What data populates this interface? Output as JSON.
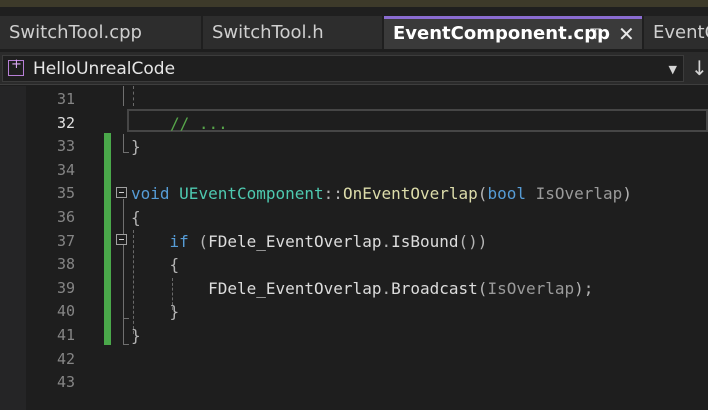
{
  "tabs": [
    {
      "label": "SwitchTool.cpp",
      "active": false
    },
    {
      "label": "SwitchTool.h",
      "active": false
    },
    {
      "label": "EventComponent.cpp",
      "active": true
    },
    {
      "label": "EventC",
      "active": false
    }
  ],
  "navbar": {
    "label": "HelloUnrealCode"
  },
  "current_line": 32,
  "lines": [
    {
      "num": "31",
      "segments": []
    },
    {
      "num": "32",
      "segments": [
        {
          "text": "// ...",
          "cls": "comment"
        }
      ]
    },
    {
      "num": "33",
      "segments": [
        {
          "text": "}",
          "cls": "punct"
        }
      ]
    },
    {
      "num": "34",
      "segments": []
    },
    {
      "num": "35",
      "segments": [
        {
          "text": "void",
          "cls": "kw"
        },
        {
          "text": " ",
          "cls": ""
        },
        {
          "text": "UEventComponent",
          "cls": "type"
        },
        {
          "text": "::",
          "cls": "punct"
        },
        {
          "text": "OnEventOverlap",
          "cls": "func"
        },
        {
          "text": "(",
          "cls": "punct"
        },
        {
          "text": "bool",
          "cls": "kw"
        },
        {
          "text": " ",
          "cls": ""
        },
        {
          "text": "IsOverlap",
          "cls": "param"
        },
        {
          "text": ")",
          "cls": "punct"
        }
      ]
    },
    {
      "num": "36",
      "segments": [
        {
          "text": "{",
          "cls": "punct"
        }
      ]
    },
    {
      "num": "37",
      "segments": [
        {
          "text": "    ",
          "cls": ""
        },
        {
          "text": "if",
          "cls": "kw"
        },
        {
          "text": " (",
          "cls": "punct"
        },
        {
          "text": "FDele_EventOverlap",
          "cls": ""
        },
        {
          "text": ".",
          "cls": "punct"
        },
        {
          "text": "IsBound",
          "cls": ""
        },
        {
          "text": "())",
          "cls": "punct"
        }
      ]
    },
    {
      "num": "38",
      "segments": [
        {
          "text": "    {",
          "cls": "punct"
        }
      ]
    },
    {
      "num": "39",
      "segments": [
        {
          "text": "        ",
          "cls": ""
        },
        {
          "text": "FDele_EventOverlap",
          "cls": ""
        },
        {
          "text": ".",
          "cls": "punct"
        },
        {
          "text": "Broadcast",
          "cls": ""
        },
        {
          "text": "(",
          "cls": "punct"
        },
        {
          "text": "IsOverlap",
          "cls": "param"
        },
        {
          "text": ");",
          "cls": "punct"
        }
      ]
    },
    {
      "num": "40",
      "segments": [
        {
          "text": "    }",
          "cls": "punct"
        }
      ]
    },
    {
      "num": "41",
      "segments": [
        {
          "text": "}",
          "cls": "punct"
        }
      ]
    },
    {
      "num": "42",
      "segments": []
    },
    {
      "num": "43",
      "segments": []
    }
  ]
}
